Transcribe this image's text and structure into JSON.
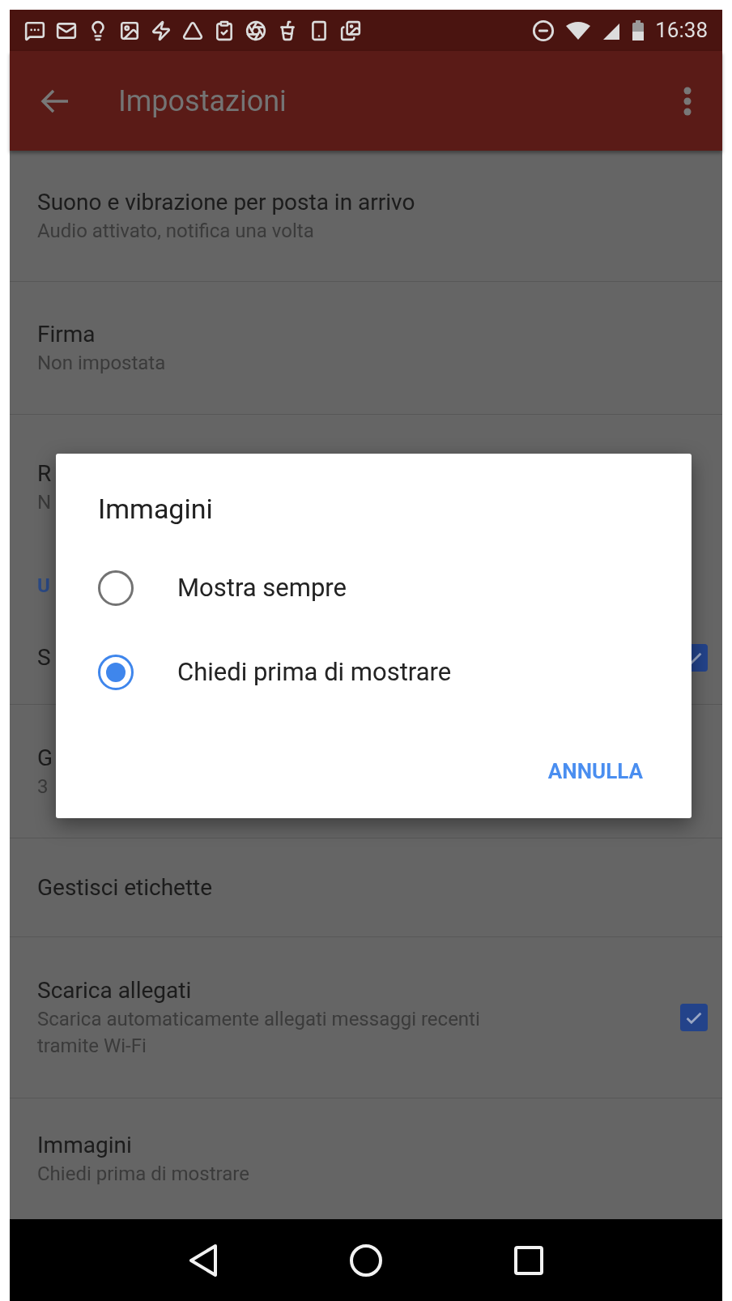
{
  "status_bar": {
    "time": "16:38"
  },
  "toolbar": {
    "title": "Impostazioni"
  },
  "settings": [
    {
      "kind": "item",
      "title": "Suono e vibrazione per posta in arrivo",
      "subtitle": "Audio attivato, notifica una volta"
    },
    {
      "kind": "item",
      "title": "Firma",
      "subtitle": "Non impostata"
    },
    {
      "kind": "item",
      "title": "R",
      "subtitle": "N"
    },
    {
      "kind": "header",
      "title": "U"
    },
    {
      "kind": "checkbox",
      "title": "S",
      "checked": true
    },
    {
      "kind": "item",
      "title": "G",
      "subtitle": "3"
    },
    {
      "kind": "item",
      "title": "Gestisci etichette"
    },
    {
      "kind": "checkbox",
      "title": "Scarica allegati",
      "subtitle": "Scarica automaticamente allegati messaggi recenti tramite Wi-Fi",
      "checked": true
    },
    {
      "kind": "item",
      "title": "Immagini",
      "subtitle": "Chiedi prima di mostrare"
    }
  ],
  "dialog": {
    "title": "Immagini",
    "options": [
      {
        "label": "Mostra sempre",
        "selected": false
      },
      {
        "label": "Chiedi prima di mostrare",
        "selected": true
      }
    ],
    "button": "ANNULLA"
  }
}
